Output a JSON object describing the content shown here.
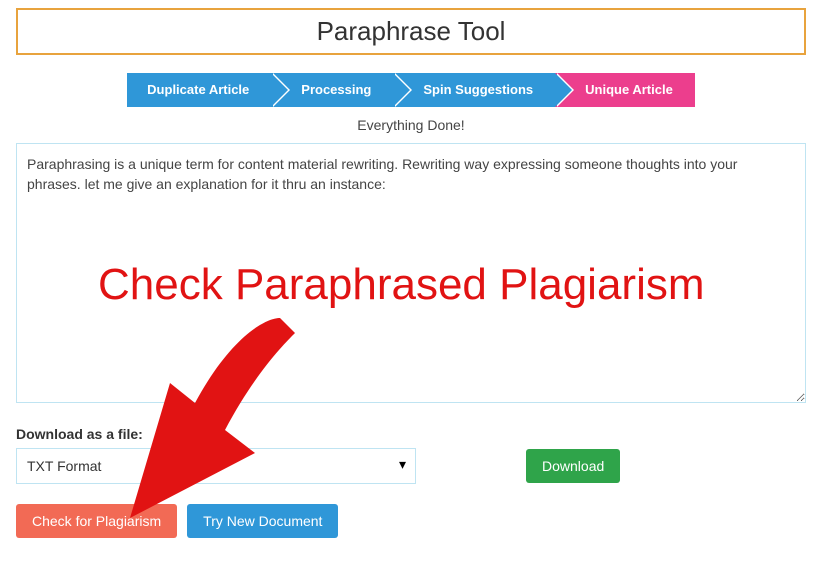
{
  "title": "Paraphrase Tool",
  "steps": [
    {
      "label": "Duplicate Article",
      "active": false
    },
    {
      "label": "Processing",
      "active": false
    },
    {
      "label": "Spin Suggestions",
      "active": false
    },
    {
      "label": "Unique Article",
      "active": true
    }
  ],
  "status_text": "Everything Done!",
  "output_text": "Paraphrasing is a unique term for content material rewriting. Rewriting way expressing someone thoughts into your phrases. let me give an explanation for it thru an instance:",
  "download": {
    "label": "Download as a file:",
    "selected": "TXT Format",
    "button": "Download"
  },
  "actions": {
    "check_plagiarism": "Check for Plagiarism",
    "try_new": "Try New Document"
  },
  "annotation": {
    "text": "Check Paraphrased Plagiarism",
    "color": "#e11313"
  }
}
